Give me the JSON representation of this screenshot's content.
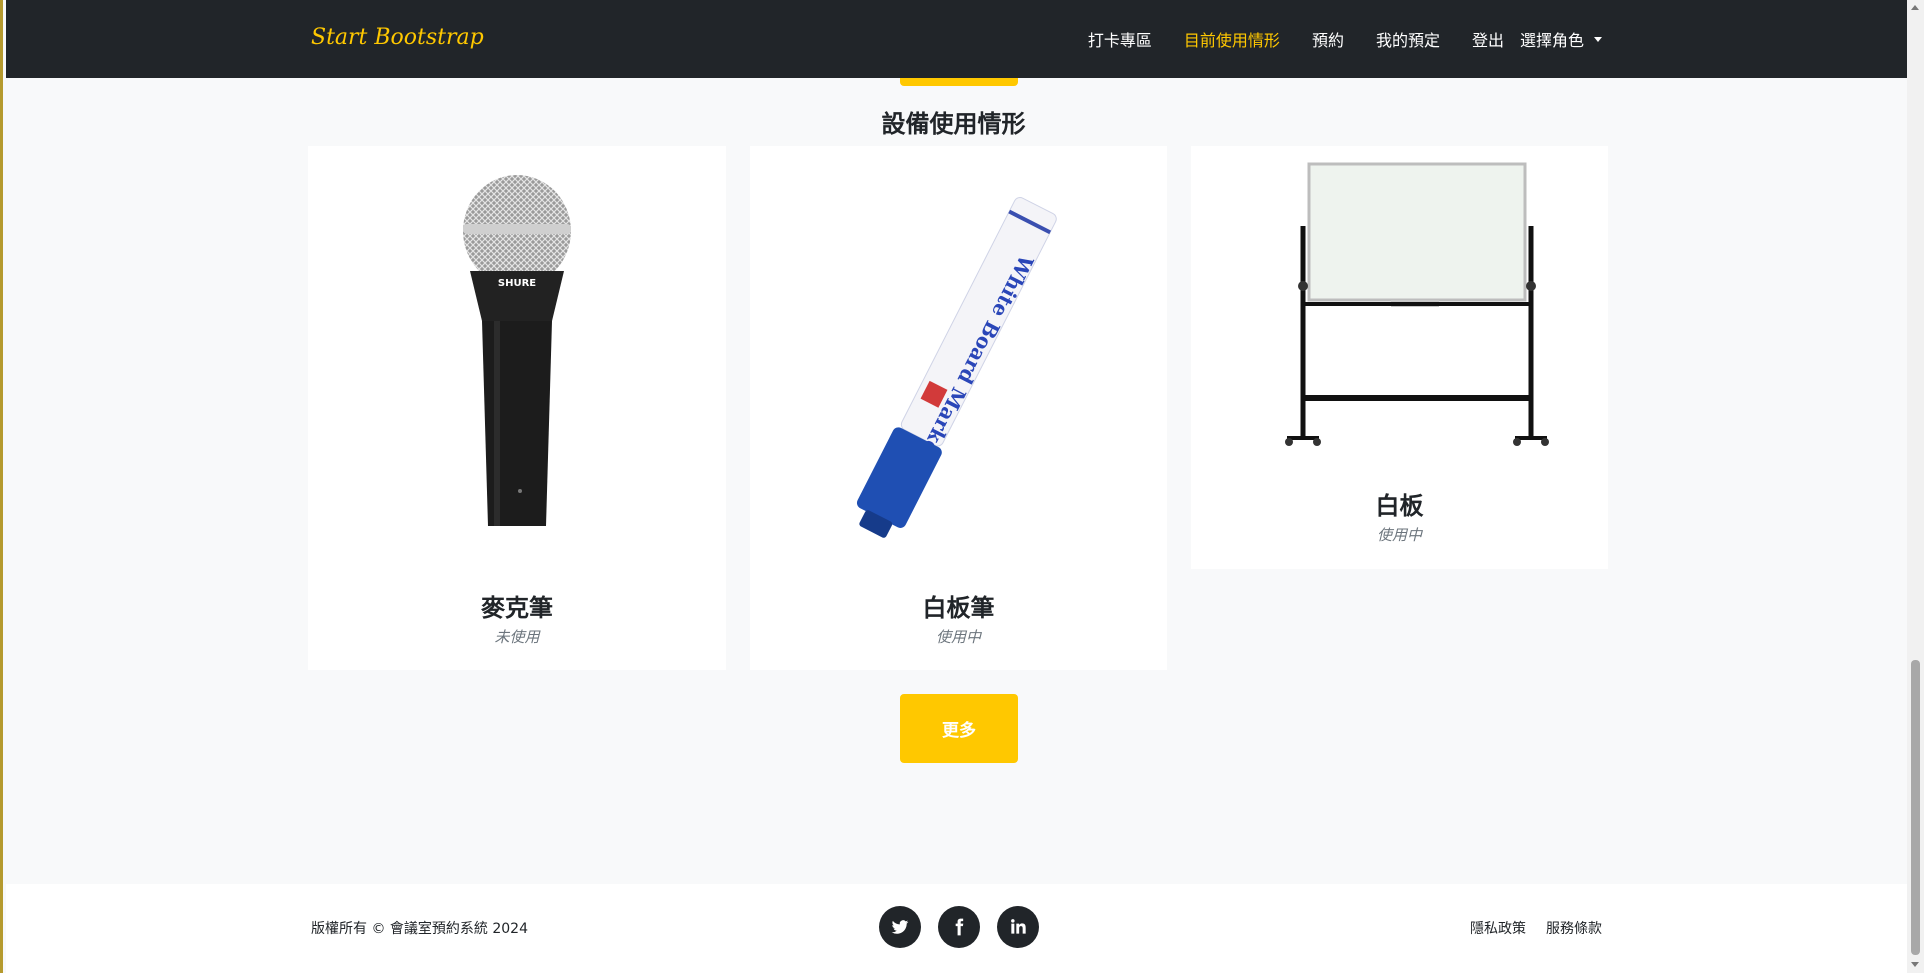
{
  "navbar": {
    "brand": "Start Bootstrap",
    "links": [
      "打卡專區",
      "目前使用情形",
      "預約",
      "我的預定",
      "登出"
    ],
    "active_index": 1,
    "dropdown_label": "選擇角色"
  },
  "section": {
    "title": "設備使用情形"
  },
  "cards": [
    {
      "title": "麥克筆",
      "status": "未使用",
      "icon": "microphone-image"
    },
    {
      "title": "白板筆",
      "status": "使用中",
      "icon": "whiteboard-marker-image"
    },
    {
      "title": "白板",
      "status": "使用中",
      "icon": "whiteboard-image"
    }
  ],
  "more_button": "更多",
  "footer": {
    "copyright": "版權所有 © 會議室預約系統 2024",
    "socials": [
      "twitter-icon",
      "facebook-icon",
      "linkedin-icon"
    ],
    "links": [
      "隱私政策",
      "服務條款"
    ]
  },
  "colors": {
    "accent": "#ffc800",
    "navbar": "#212529",
    "background": "#f8f9fa"
  }
}
